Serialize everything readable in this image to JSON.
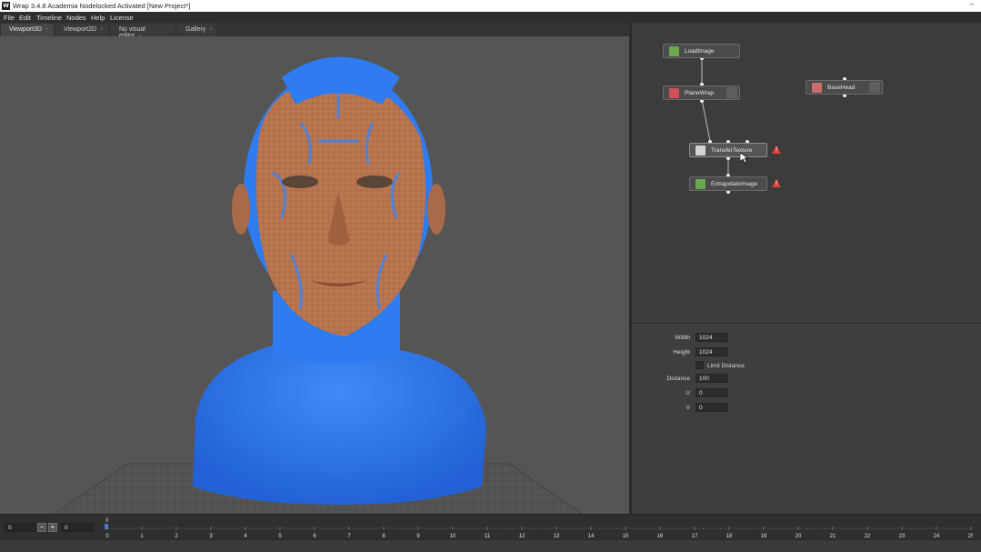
{
  "window": {
    "title": "Wrap 3.4.8 Academia Nodelocked Activated [New Project*]",
    "logo": "W",
    "minimize_glyph": "–"
  },
  "menu": [
    "File",
    "Edit",
    "Timeline",
    "Nodes",
    "Help",
    "License"
  ],
  "tabs": [
    {
      "label": "Viewport3D",
      "active": true
    },
    {
      "label": "Viewport2D",
      "active": false
    },
    {
      "label": "No visual editor",
      "active": false
    },
    {
      "label": "Gallery",
      "active": false
    }
  ],
  "tab_close_glyph": "×",
  "nodes": {
    "load_image": {
      "label": "LoadImage",
      "icon": "image-icon"
    },
    "plane_wrap": {
      "label": "PlaneWrap",
      "icon": "wrap-icon"
    },
    "transfer_texture": {
      "label": "TransferTexture",
      "icon": "texture-icon"
    },
    "extrapolate_image": {
      "label": "ExtrapolateImage",
      "icon": "image-icon"
    },
    "base_head": {
      "label": "BaseHead",
      "icon": "geometry-icon"
    },
    "warning_glyph": "!"
  },
  "properties": {
    "width_label": "Width",
    "width_value": "1024",
    "height_label": "Height",
    "height_value": "1024",
    "limit_distance_label": "Limit Distance",
    "distance_label": "Distance",
    "distance_value": "100",
    "u_label": "U",
    "u_value": "0",
    "v_label": "V",
    "v_value": "0"
  },
  "timeline": {
    "frame_value": "0",
    "minus_label": "−",
    "plus_label": "+",
    "end_value": "0",
    "current_frame_label": "0",
    "ticks": [
      "0",
      "1",
      "2",
      "3",
      "4",
      "5",
      "6",
      "7",
      "8",
      "9",
      "10",
      "11",
      "12",
      "13",
      "14",
      "15",
      "16",
      "17",
      "18",
      "19",
      "20",
      "21",
      "22",
      "23",
      "24",
      "25"
    ]
  },
  "colors": {
    "mesh_blue": "#2f7bf0",
    "skin": "#b8744d",
    "viewport_bg": "#555555",
    "warning": "#e0413b"
  }
}
